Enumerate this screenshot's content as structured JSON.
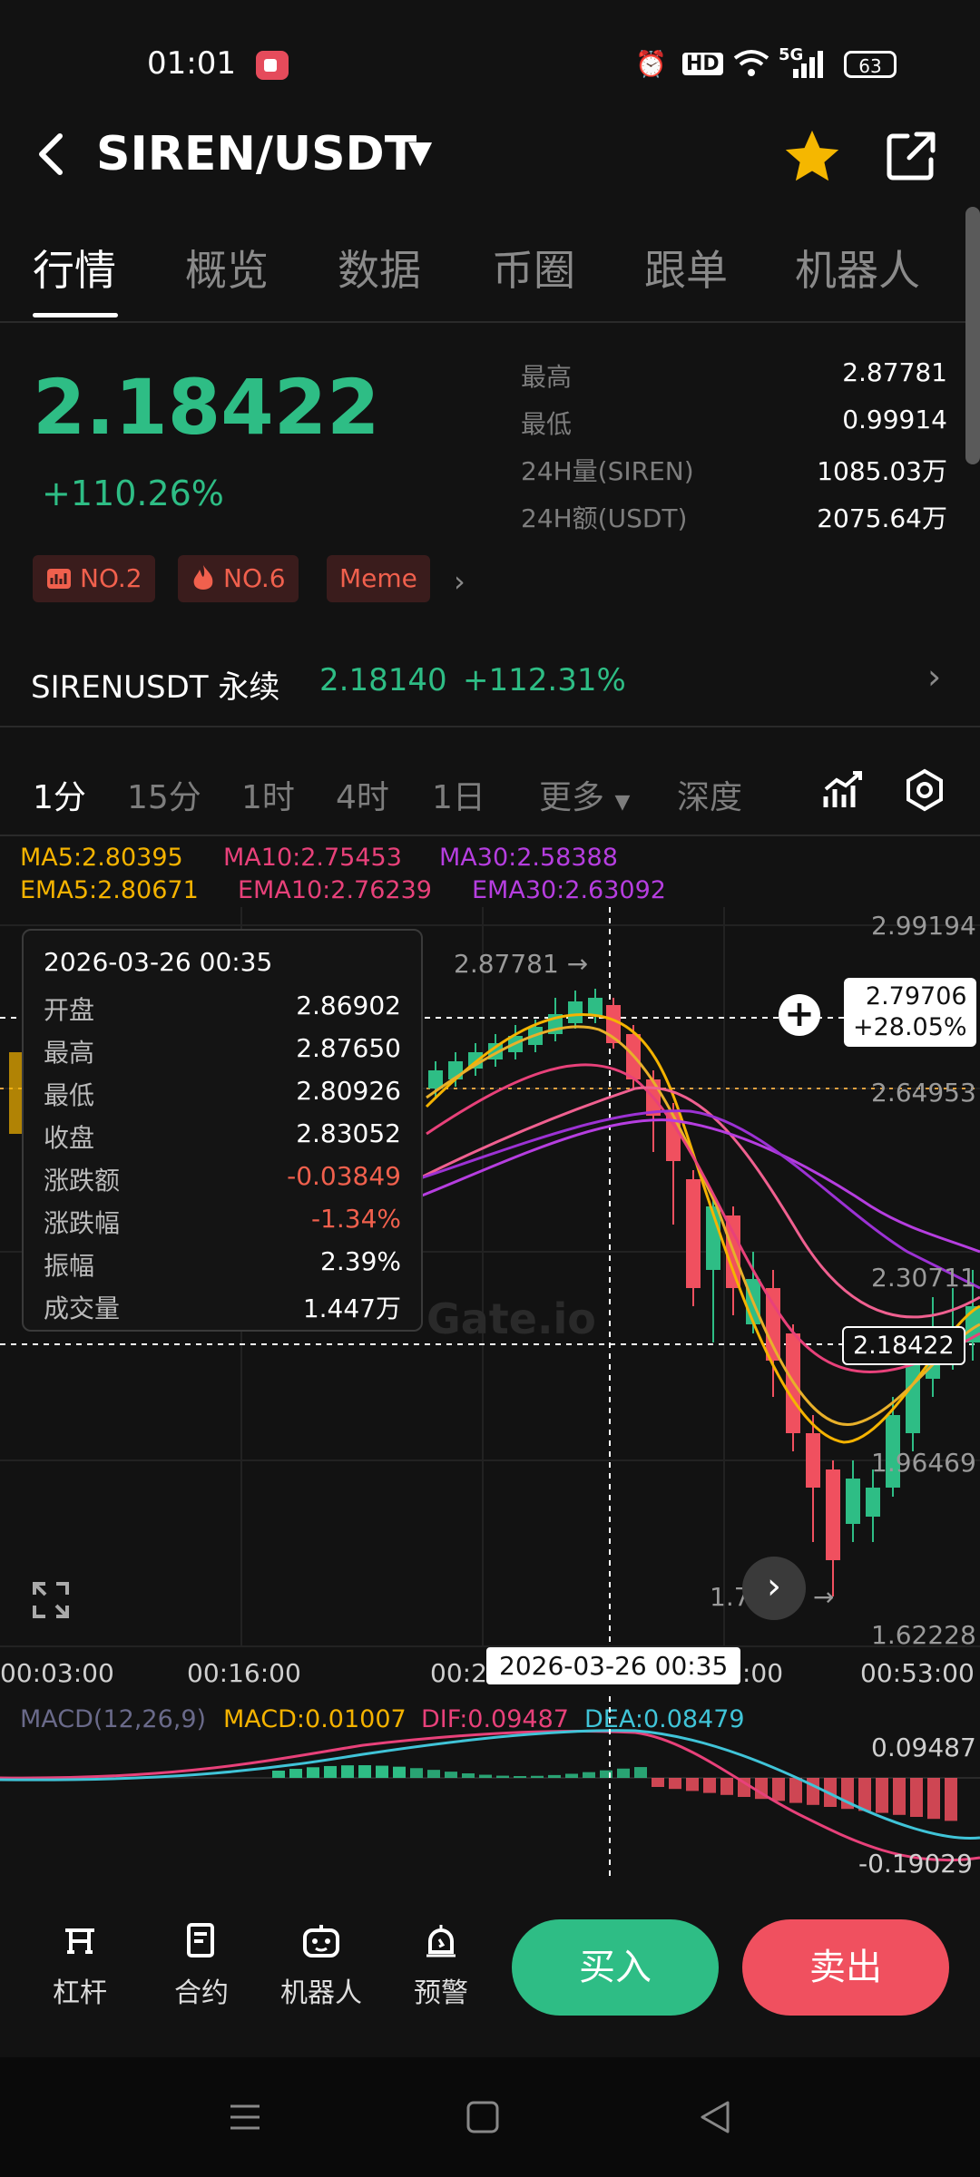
{
  "status_bar": {
    "time": "01:01",
    "hd": "HD",
    "network": "5G",
    "battery": "63"
  },
  "header": {
    "pair": "SIREN/USDT"
  },
  "tabs": [
    "行情",
    "概览",
    "数据",
    "币圈",
    "跟单",
    "机器人"
  ],
  "price": {
    "last": "2.18422",
    "change_pct": "+110.26%",
    "stats": [
      {
        "label": "最高",
        "value": "2.87781"
      },
      {
        "label": "最低",
        "value": "0.99914"
      },
      {
        "label": "24H量(SIREN)",
        "value": "1085.03万"
      },
      {
        "label": "24H额(USDT)",
        "value": "2075.64万"
      }
    ],
    "badges": [
      {
        "icon": "chart-icon",
        "text": "NO.2"
      },
      {
        "icon": "fire-icon",
        "text": "NO.6"
      },
      {
        "icon": "",
        "text": "Meme"
      }
    ]
  },
  "perpetual": {
    "name": "SIRENUSDT 永续",
    "price": "2.18140",
    "change": "+112.31%"
  },
  "intervals": [
    "1分",
    "15分",
    "1时",
    "4时",
    "1日",
    "更多",
    "深度"
  ],
  "ma": {
    "ma5": "MA5:2.80395",
    "ma10": "MA10:2.75453",
    "ma30": "MA30:2.58388",
    "ema5": "EMA5:2.80671",
    "ema10": "EMA10:2.76239",
    "ema30": "EMA30:2.63092"
  },
  "tooltip": {
    "datetime": "2026-03-26 00:35",
    "rows": [
      {
        "label": "开盘",
        "value": "2.86902"
      },
      {
        "label": "最高",
        "value": "2.87650"
      },
      {
        "label": "最低",
        "value": "2.80926"
      },
      {
        "label": "收盘",
        "value": "2.83052"
      },
      {
        "label": "涨跌额",
        "value": "-0.03849"
      },
      {
        "label": "涨跌幅",
        "value": "-1.34%"
      },
      {
        "label": "振幅",
        "value": "2.39%"
      },
      {
        "label": "成交量",
        "value": "1.447万"
      }
    ]
  },
  "chart": {
    "y_labels": [
      "2.99194",
      "2.64953",
      "2.30711",
      "1.96469",
      "1.62228"
    ],
    "high_marker": "2.87781 →",
    "low_marker": "1.7",
    "crosshair_price": "2.79706",
    "crosshair_pct": "+28.05%",
    "last_price_tag": "2.18422",
    "x_labels": [
      "00:03:00",
      "00:16:00",
      "00:2",
      ":00",
      "00:53:00"
    ],
    "crosshair_time": "2026-03-26 00:35",
    "watermark": "Gate.io"
  },
  "macd": {
    "params": "MACD(12,26,9)",
    "macd": "MACD:0.01007",
    "dif": "DIF:0.09487",
    "dea": "DEA:0.08479",
    "top": "0.09487",
    "bottom": "-0.19029"
  },
  "bottom_bar": {
    "items": [
      "杠杆",
      "合约",
      "机器人",
      "预警"
    ],
    "buy": "买入",
    "sell": "卖出"
  },
  "colors": {
    "green": "#2ebd85",
    "red": "#f0505f",
    "ma5": "#f5b300",
    "ma10": "#e8417a",
    "ma30": "#b63ee0"
  }
}
